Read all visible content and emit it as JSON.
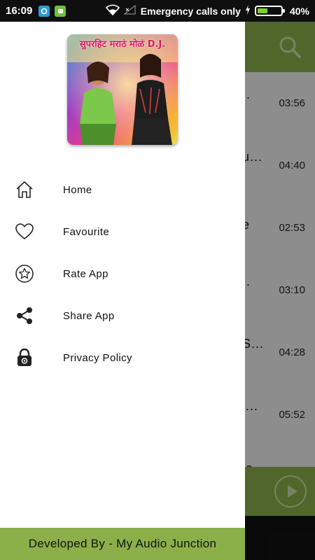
{
  "status_bar": {
    "time": "16:09",
    "network_text": "Emergency calls only",
    "battery_text": "40%",
    "battery_level": 0.4
  },
  "app": {
    "tracks": [
      {
        "title": "..",
        "duration": "03:56"
      },
      {
        "title": "u...",
        "duration": "04:40"
      },
      {
        "title": "e",
        "duration": "02:53"
      },
      {
        "title": "..",
        "duration": "03:10"
      },
      {
        "title": "S...",
        "duration": "04:28"
      },
      {
        "title": "i...",
        "duration": "05:52"
      },
      {
        "title": "la",
        "duration": ""
      }
    ]
  },
  "drawer": {
    "album_art_text": "सुपरहिट मराठं मोळं D.J.",
    "menu": [
      {
        "label": "Home",
        "icon": "home-icon"
      },
      {
        "label": "Favourite",
        "icon": "heart-icon"
      },
      {
        "label": "Rate App",
        "icon": "star-icon"
      },
      {
        "label": "Share App",
        "icon": "share-icon"
      },
      {
        "label": "Privacy Policy",
        "icon": "lock-icon"
      }
    ],
    "footer": "Developed By - My Audio Junction"
  },
  "colors": {
    "accent_green": "#8bb04a",
    "status_bar": "#0f0f0f",
    "drawer_bg": "#ffffff"
  }
}
